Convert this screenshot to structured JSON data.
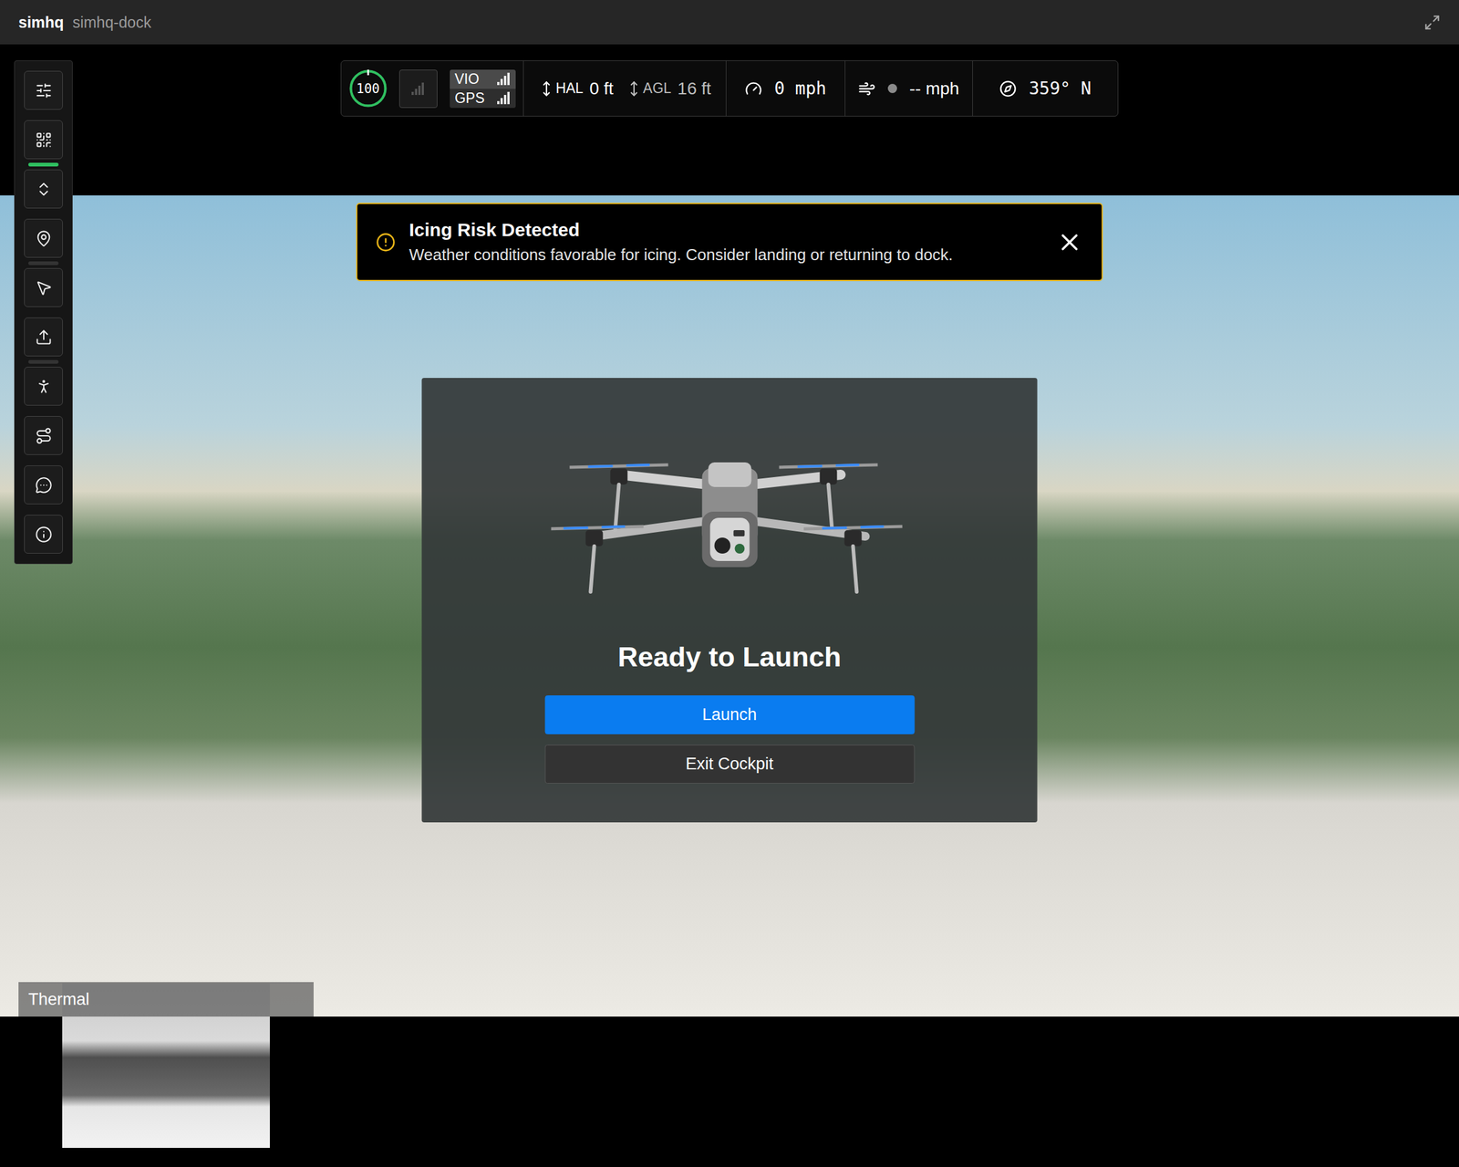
{
  "window": {
    "brand": "simhq",
    "title": "simhq-dock"
  },
  "toolbar": {
    "items": [
      {
        "name": "settings",
        "marker": false,
        "active": false
      },
      {
        "name": "qr-code",
        "marker": false,
        "active": false
      },
      {
        "name": "recenter",
        "marker": true,
        "active": true
      },
      {
        "name": "location",
        "marker": false,
        "active": false
      },
      {
        "name": "pointer",
        "marker": true,
        "active": false
      },
      {
        "name": "upload",
        "marker": false,
        "active": false
      },
      {
        "name": "follow",
        "marker": true,
        "active": false
      },
      {
        "name": "route",
        "marker": false,
        "active": false
      },
      {
        "name": "chat",
        "marker": false,
        "active": false
      },
      {
        "name": "info",
        "marker": false,
        "active": false
      }
    ]
  },
  "telemetry": {
    "battery": {
      "value": "100",
      "level": 1
    },
    "signal": {
      "level": 0
    },
    "links": [
      {
        "label": "VIO",
        "level": 1
      },
      {
        "label": "GPS",
        "level": 1
      }
    ],
    "altitudes": [
      {
        "label": "HAL",
        "value": "0 ft",
        "dimmed": false
      },
      {
        "label": "AGL",
        "value": "16 ft",
        "dimmed": true
      }
    ],
    "speed": "0 mph",
    "wind": "-- mph",
    "heading": "359° N"
  },
  "alert": {
    "title": "Icing Risk Detected",
    "message": "Weather conditions favorable for icing. Consider landing or returning to dock."
  },
  "launch": {
    "title": "Ready to Launch",
    "buttons": [
      {
        "label": "Launch",
        "primary": true
      },
      {
        "label": "Exit Cockpit",
        "primary": false
      }
    ]
  },
  "thermal": {
    "label": "Thermal"
  }
}
